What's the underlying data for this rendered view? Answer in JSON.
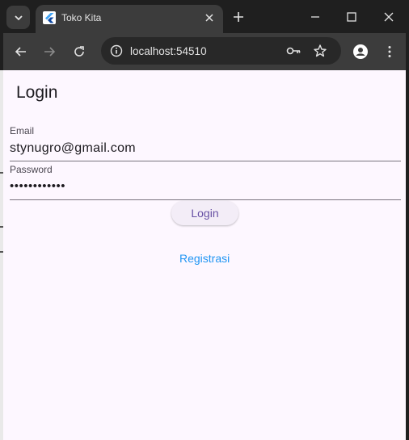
{
  "browser": {
    "tab_title": "Toko Kita",
    "url": "localhost:54510"
  },
  "app": {
    "title": "Login",
    "email_label": "Email",
    "email_value": "stynugro@gmail.com",
    "password_label": "Password",
    "password_value": "••••••••••••",
    "login_button": "Login",
    "register_link": "Registrasi"
  },
  "colors": {
    "page_background": "#fdf7ff",
    "button_text": "#6750a4",
    "link": "#2196f3"
  }
}
